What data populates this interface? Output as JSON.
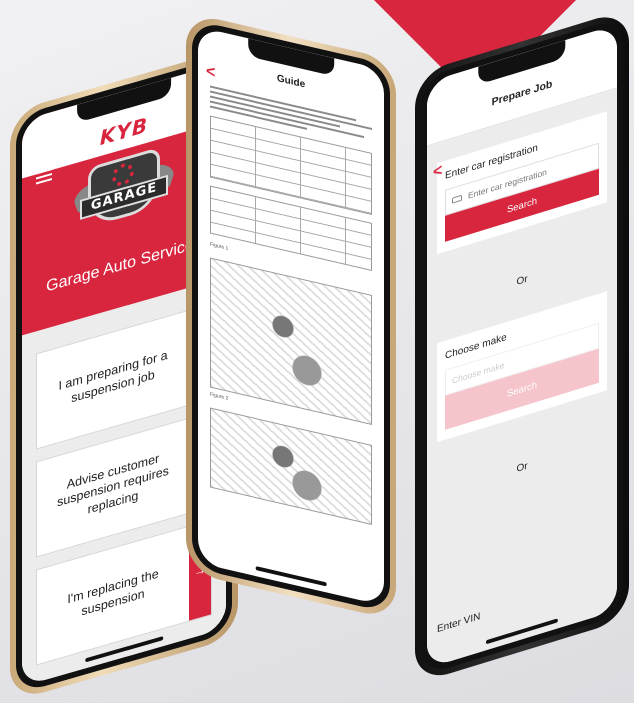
{
  "brand": {
    "accent": "#d9263f",
    "logo_text": "KYB"
  },
  "phone_left": {
    "status_text": "••• ●",
    "badge_text": "GARAGE",
    "garage_name": "Garage Auto Services",
    "menu_items": [
      {
        "label": "I am preparing for a suspension job",
        "arrow": "→"
      },
      {
        "label": "Advise customer suspension requires replacing",
        "arrow": "→"
      },
      {
        "label": "I'm replacing the suspension",
        "arrow": "→"
      }
    ]
  },
  "phone_mid": {
    "back": "<",
    "title": "Guide",
    "figure_labels": [
      "Figure 1",
      "Figure 2"
    ]
  },
  "phone_right": {
    "back": "<",
    "title": "Prepare Job",
    "registration": {
      "label": "Enter car registration",
      "placeholder": "Enter car registration",
      "button": "Search"
    },
    "or_1": "Or",
    "make": {
      "label": "Choose make",
      "placeholder": "Choose make",
      "button": "Search"
    },
    "or_2": "Or",
    "vin_label": "Enter VIN"
  }
}
